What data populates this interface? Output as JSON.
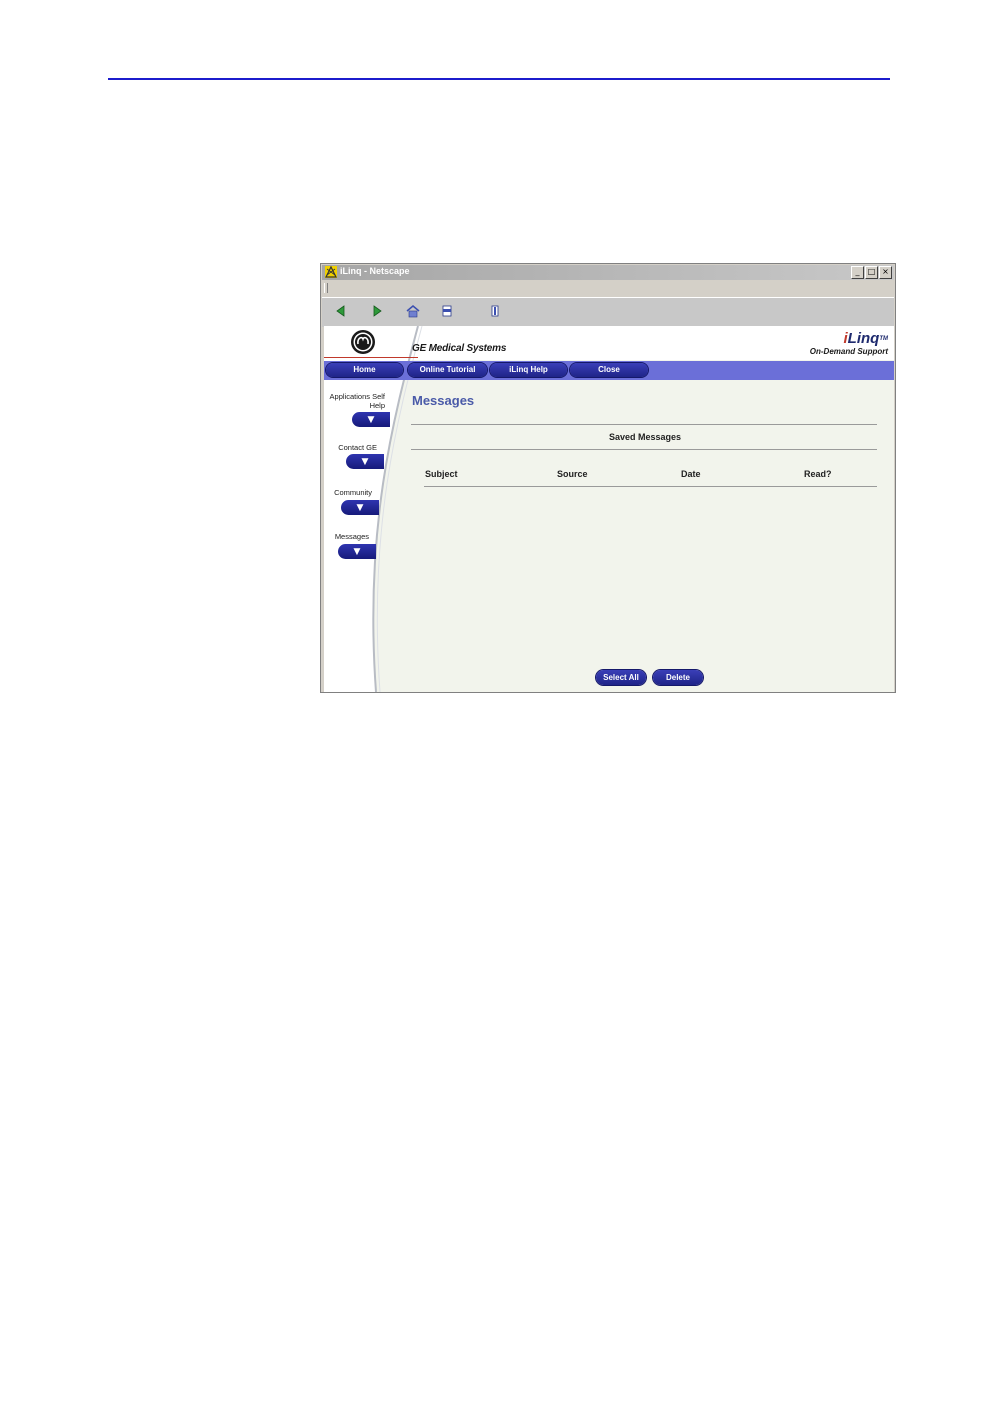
{
  "window": {
    "title": "iLinq - Netscape",
    "min_glyph": "_",
    "max_glyph": "□",
    "close_glyph": "×"
  },
  "header": {
    "brand": "GE Medical Systems",
    "product_i": "i",
    "product_rest": "Linq",
    "trademark": "TM",
    "tagline": "On-Demand Support"
  },
  "nav": {
    "home": "Home",
    "online_tutorial": "Online Tutorial",
    "ilinq_help": "iLinq Help",
    "close": "Close"
  },
  "sidebar": {
    "items": [
      {
        "label_line1": "Applications Self",
        "label_line2": "Help",
        "arrow": "▼"
      },
      {
        "label_line1": "Contact GE",
        "label_line2": "",
        "arrow": "▼"
      },
      {
        "label_line1": "Community",
        "label_line2": "",
        "arrow": "▼"
      },
      {
        "label_line1": "Messages",
        "label_line2": "",
        "arrow": "▼"
      }
    ]
  },
  "main": {
    "title": "Messages",
    "section_title": "Saved Messages",
    "columns": [
      "Subject",
      "Source",
      "Date",
      "Read?"
    ],
    "select_all": "Select All",
    "delete": "Delete"
  },
  "colors": {
    "nav_bar": "#6b6fd8",
    "button_blue": "#1f2488",
    "page_rule": "#1c1ccc",
    "accent_red": "#c0392b"
  }
}
